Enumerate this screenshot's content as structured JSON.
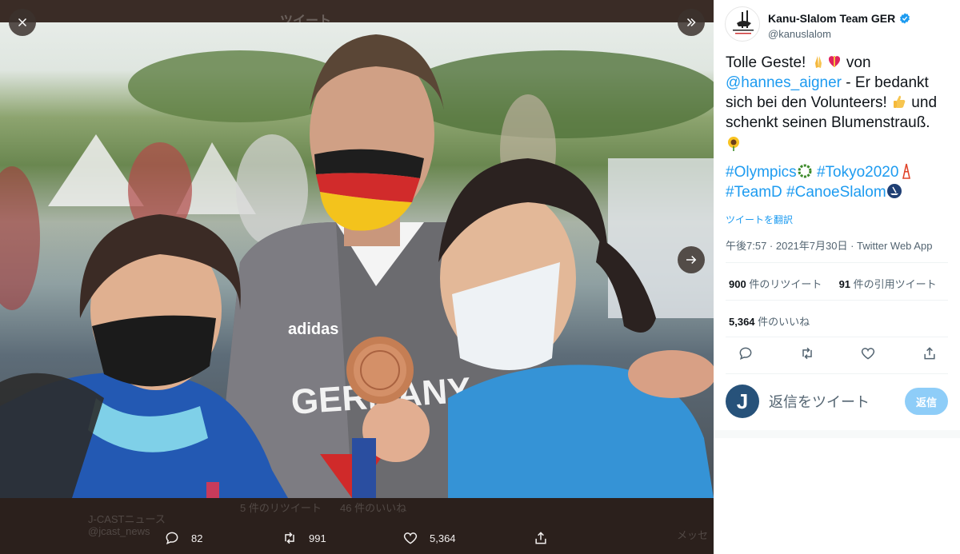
{
  "background": {
    "header_ghost": "ツイート",
    "account_ghost": "J-CASTニュース",
    "handle_ghost": "@jcast_news",
    "retweets_ghost": "5 件のリツイート",
    "likes_ghost": "46 件のいいね",
    "message_ghost": "メッセ"
  },
  "photo": {
    "alt": "Canoe slalom bronze medalist with volunteers",
    "medal_text": "GERMANY",
    "brand": "adidas"
  },
  "controls": {
    "close": "close-icon",
    "expand": "double-chevron-right-icon",
    "next": "arrow-right-icon"
  },
  "bottom_stats": {
    "replies": "82",
    "retweets": "991",
    "likes": "5,364"
  },
  "tweet": {
    "display_name": "Kanu-Slalom Team GER",
    "handle": "@kanuslalom",
    "text_1": "Tolle Geste! ",
    "text_2": " von",
    "mention": "@hannes_aigner",
    "text_3": " - Er bedankt sich bei den Volunteers! ",
    "text_4": " und schenkt seinen Blumenstrauß.",
    "hashtag_1": "#Olympics",
    "hashtag_2": "#Tokyo2020",
    "hashtag_3": "#TeamD",
    "hashtag_4": "#CanoeSlalom",
    "translate": "ツイートを翻訳",
    "meta": "午後7:57 · 2021年7月30日 · Twitter Web App",
    "retweet_count": "900",
    "retweet_label": " 件のリツイート",
    "quote_count": "91",
    "quote_label": " 件の引用ツイート",
    "like_count": "5,364",
    "like_label": " 件のいいね"
  },
  "reply": {
    "avatar_letter": "J",
    "placeholder": "返信をツイート",
    "button": "返信"
  },
  "colors": {
    "accent": "#1d9bf0",
    "reply_button": "#8ecdf8",
    "viewer_bg": "#2a201c"
  }
}
